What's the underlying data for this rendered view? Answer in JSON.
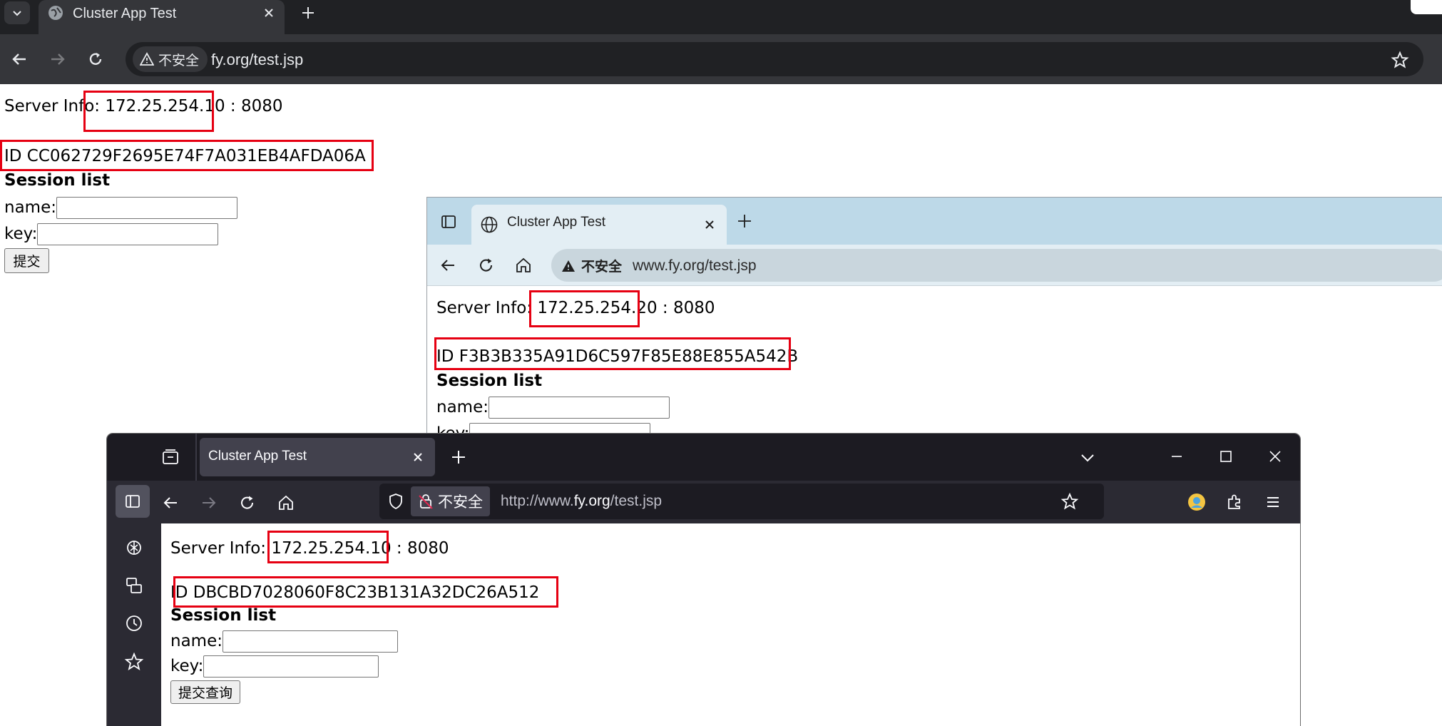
{
  "chrome_window": {
    "tab_title": "Cluster App Test",
    "security_label": "不安全",
    "url": "fy.org/test.jsp",
    "server_info_label": "Server Info:",
    "server_ip": "172.25.254.10",
    "server_port": ": 8080",
    "session_id": "ID CC062729F2695E74F7A031EB4AFDA06A",
    "session_list_label": "Session list",
    "name_label": "name:",
    "key_label": "key:",
    "submit_label": "提交"
  },
  "edge_window": {
    "tab_title": "Cluster App Test",
    "security_label": "不安全",
    "url": "www.fy.org/test.jsp",
    "server_info_label": "Server Info:",
    "server_ip": "172.25.254.20",
    "server_port": ": 8080",
    "session_id": "ID F3B3B335A91D6C597F85E88E855A542B",
    "session_list_label": "Session list",
    "name_label": "name:",
    "key_label": "key:"
  },
  "firefox_window": {
    "tab_title": "Cluster App Test",
    "security_label": "不安全",
    "url_prefix": "http://www.",
    "url_domain": "fy.org",
    "url_path": "/test.jsp",
    "server_info_label": "Server Info:",
    "server_ip": "172.25.254.10",
    "server_port": ": 8080",
    "session_id": "ID DBCBD7028060F8C23B131A32DC26A512",
    "session_list_label": "Session list",
    "name_label": "name:",
    "key_label": "key:",
    "submit_label": "提交查询"
  },
  "colors": {
    "highlight_box": "#e60012",
    "chrome_frame": "#202124",
    "edge_frame": "#bdd9e8",
    "firefox_frame": "#1c1b22"
  }
}
